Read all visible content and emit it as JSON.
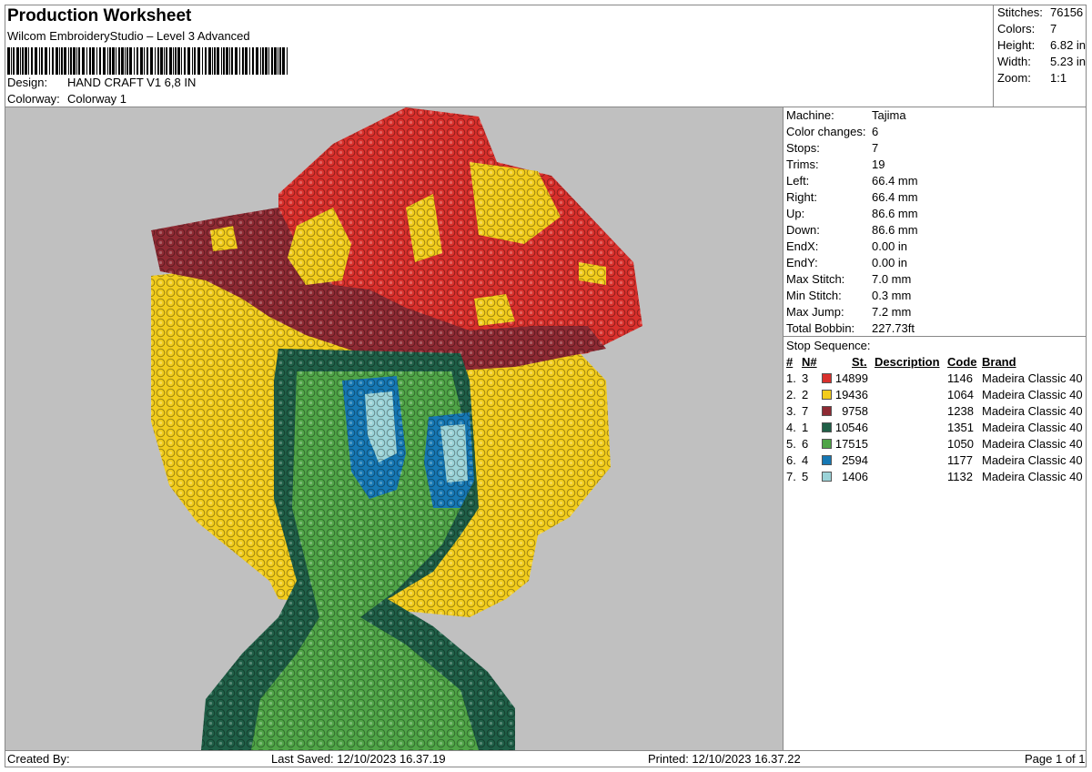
{
  "header": {
    "title": "Production Worksheet",
    "software": "Wilcom EmbroideryStudio – Level 3 Advanced",
    "design_label": "Design:",
    "design_value": "HAND CRAFT V1 6,8 IN",
    "colorway_label": "Colorway:",
    "colorway_value": "Colorway 1"
  },
  "stats": [
    {
      "label": "Stitches:",
      "value": "76156"
    },
    {
      "label": "Colors:",
      "value": "7"
    },
    {
      "label": "Height:",
      "value": "6.82 in"
    },
    {
      "label": "Width:",
      "value": "5.23 in"
    },
    {
      "label": "Zoom:",
      "value": "1:1"
    }
  ],
  "info": [
    {
      "label": "Machine:",
      "value": "Tajima"
    },
    {
      "label": "Color changes:",
      "value": "6"
    },
    {
      "label": "Stops:",
      "value": "7"
    },
    {
      "label": "Trims:",
      "value": "19"
    },
    {
      "label": "Left:",
      "value": "66.4 mm"
    },
    {
      "label": "Right:",
      "value": "66.4 mm"
    },
    {
      "label": "Up:",
      "value": "86.6 mm"
    },
    {
      "label": "Down:",
      "value": "86.6 mm"
    },
    {
      "label": "EndX:",
      "value": "0.00 in"
    },
    {
      "label": "EndY:",
      "value": "0.00 in"
    },
    {
      "label": "Max Stitch:",
      "value": "7.0 mm"
    },
    {
      "label": "Min Stitch:",
      "value": "0.3 mm"
    },
    {
      "label": "Max Jump:",
      "value": "7.2 mm"
    },
    {
      "label": "Total Bobbin:",
      "value": "227.73ft"
    }
  ],
  "stop_sequence": {
    "title": "Stop Sequence:",
    "headers": {
      "num": "#",
      "n": "N#",
      "st": "St.",
      "desc": "Description",
      "code": "Code",
      "brand": "Brand"
    },
    "rows": [
      {
        "idx": "1.",
        "n": "3",
        "color": "#d9302c",
        "st": "14899",
        "code": "1146",
        "brand": "Madeira Classic 40"
      },
      {
        "idx": "2.",
        "n": "2",
        "color": "#f2cc1c",
        "st": "19436",
        "code": "1064",
        "brand": "Madeira Classic 40"
      },
      {
        "idx": "3.",
        "n": "7",
        "color": "#8e2a33",
        "st": "9758",
        "code": "1238",
        "brand": "Madeira Classic 40"
      },
      {
        "idx": "4.",
        "n": "1",
        "color": "#1f5f47",
        "st": "10546",
        "code": "1351",
        "brand": "Madeira Classic 40"
      },
      {
        "idx": "5.",
        "n": "6",
        "color": "#4fa447",
        "st": "17515",
        "code": "1050",
        "brand": "Madeira Classic 40"
      },
      {
        "idx": "6.",
        "n": "4",
        "color": "#1678b4",
        "st": "2594",
        "code": "1177",
        "brand": "Madeira Classic 40"
      },
      {
        "idx": "7.",
        "n": "5",
        "color": "#9bd3d8",
        "st": "1406",
        "code": "1132",
        "brand": "Madeira Classic 40"
      }
    ]
  },
  "footer": {
    "created_by": "Created By:",
    "last_saved": "Last Saved: 12/10/2023 16.37.19",
    "printed": "Printed: 12/10/2023 16.37.22",
    "page": "Page 1 of 1"
  },
  "design_preview": {
    "background": "#c0c0c0",
    "colors": {
      "red": "#d9302c",
      "yellow": "#f2cc1c",
      "maroon": "#8e2a33",
      "dark_green": "#1f5f47",
      "green": "#4fa447",
      "blue": "#1678b4",
      "light_blue": "#9bd3d8"
    }
  }
}
